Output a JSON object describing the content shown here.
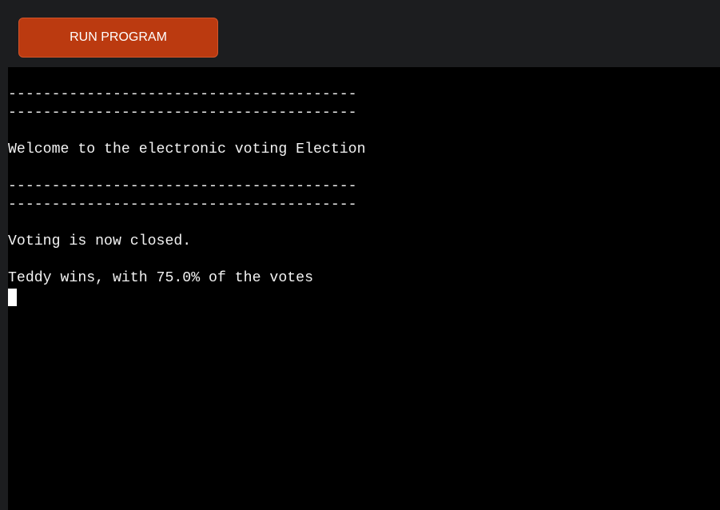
{
  "toolbar": {
    "run_label": "RUN PROGRAM"
  },
  "terminal": {
    "lines": [
      "----------------------------------------",
      "----------------------------------------",
      "",
      "Welcome to the electronic voting Election",
      "",
      "----------------------------------------",
      "----------------------------------------",
      "",
      "Voting is now closed.",
      "",
      "Teddy wins, with 75.0% of the votes"
    ]
  },
  "colors": {
    "button": "#bb3a10",
    "terminal_bg": "#000000",
    "chrome_bg": "#1c1d1f",
    "text": "#f2f2f2"
  }
}
